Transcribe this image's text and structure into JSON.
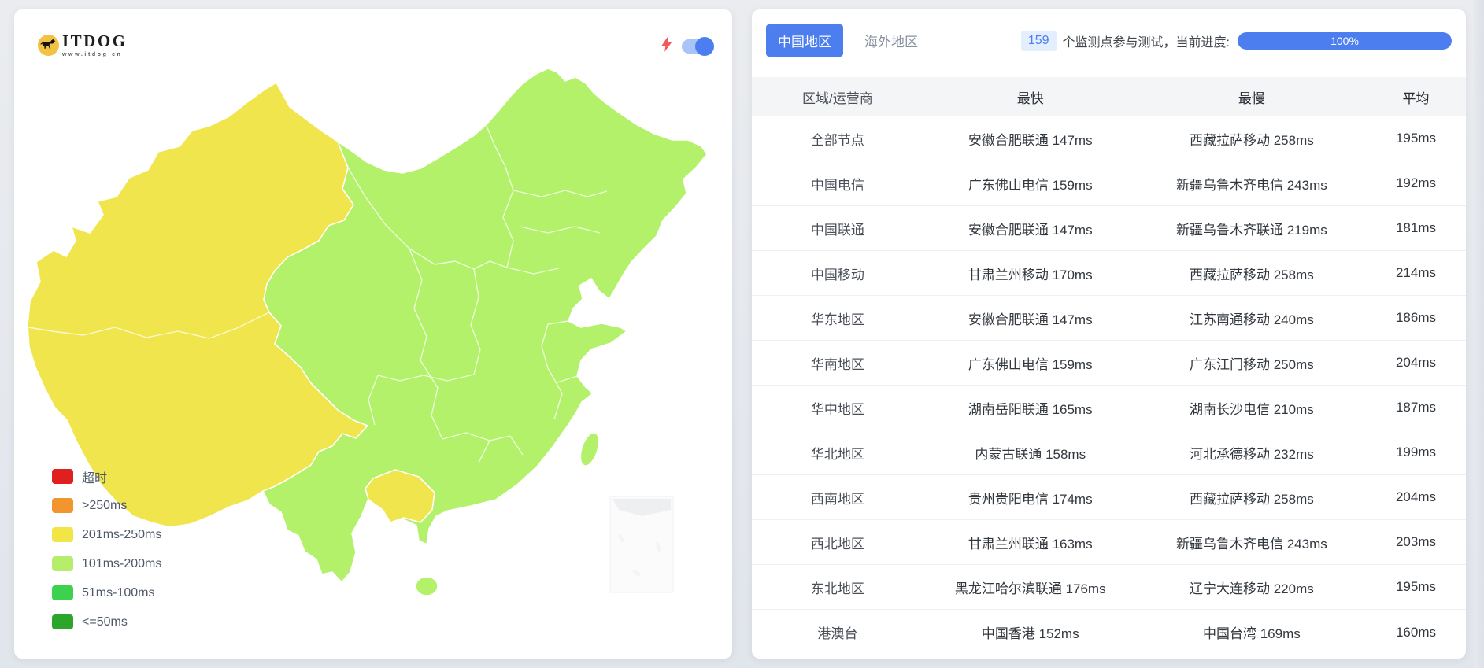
{
  "accent": "#4C7EF0",
  "left_panel": {
    "logo": {
      "brand": "ITDOG",
      "site": "www.itdog.cn"
    },
    "controls": {
      "lightning_icon": "lightning-bolt",
      "toggle_state": "on"
    },
    "map_colors": {
      "yellow": "#F0E54C",
      "green": "#B2F169",
      "border": "#FFFFFF"
    },
    "legend": [
      {
        "label": "超时",
        "color": "#E01F1F"
      },
      {
        "label": ">250ms",
        "color": "#F2952F"
      },
      {
        "label": "201ms-250ms",
        "color": "#F2E546"
      },
      {
        "label": "101ms-200ms",
        "color": "#B6EE6C"
      },
      {
        "label": "51ms-100ms",
        "color": "#3CD14F"
      },
      {
        "label": "<=50ms",
        "color": "#2BA62B"
      }
    ]
  },
  "right_panel": {
    "tabs": [
      {
        "label": "中国地区",
        "active": true
      },
      {
        "label": "海外地区",
        "active": false
      }
    ],
    "monitor_count": "159",
    "monitor_text": "个监测点参与测试，当前进度:",
    "progress": "100%",
    "table": {
      "headers": [
        "区域/运营商",
        "最快",
        "最慢",
        "平均"
      ],
      "rows": [
        [
          "全部节点",
          "安徽合肥联通 147ms",
          "西藏拉萨移动 258ms",
          "195ms"
        ],
        [
          "中国电信",
          "广东佛山电信 159ms",
          "新疆乌鲁木齐电信 243ms",
          "192ms"
        ],
        [
          "中国联通",
          "安徽合肥联通 147ms",
          "新疆乌鲁木齐联通 219ms",
          "181ms"
        ],
        [
          "中国移动",
          "甘肃兰州移动 170ms",
          "西藏拉萨移动 258ms",
          "214ms"
        ],
        [
          "华东地区",
          "安徽合肥联通 147ms",
          "江苏南通移动 240ms",
          "186ms"
        ],
        [
          "华南地区",
          "广东佛山电信 159ms",
          "广东江门移动 250ms",
          "204ms"
        ],
        [
          "华中地区",
          "湖南岳阳联通 165ms",
          "湖南长沙电信 210ms",
          "187ms"
        ],
        [
          "华北地区",
          "内蒙古联通 158ms",
          "河北承德移动 232ms",
          "199ms"
        ],
        [
          "西南地区",
          "贵州贵阳电信 174ms",
          "西藏拉萨移动 258ms",
          "204ms"
        ],
        [
          "西北地区",
          "甘肃兰州联通 163ms",
          "新疆乌鲁木齐电信 243ms",
          "203ms"
        ],
        [
          "东北地区",
          "黑龙江哈尔滨联通 176ms",
          "辽宁大连移动 220ms",
          "195ms"
        ],
        [
          "港澳台",
          "中国香港 152ms",
          "中国台湾 169ms",
          "160ms"
        ]
      ]
    }
  }
}
